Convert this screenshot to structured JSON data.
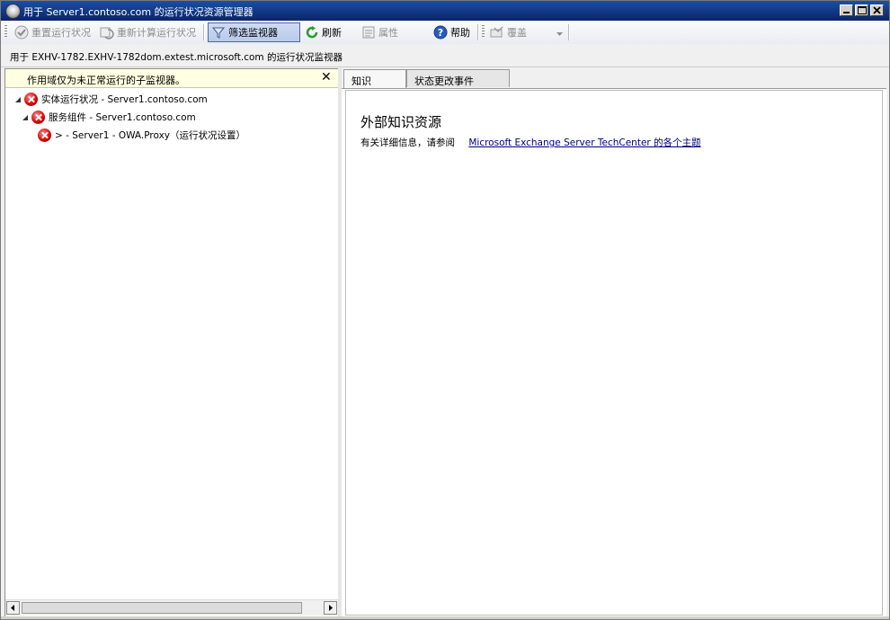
{
  "window": {
    "title": "用于 Server1.contoso.com 的运行状况资源管理器"
  },
  "toolbar": {
    "reset_health": "重置运行状况",
    "recalc_health": "重新计算运行状况",
    "filter_monitors": "筛选监视器",
    "refresh": "刷新",
    "properties": "属性",
    "help": "帮助",
    "override": "覆盖"
  },
  "infobar": {
    "text": "用于 EXHV-1782.EXHV-1782dom.extest.microsoft.com 的运行状况监视器"
  },
  "left_pane": {
    "scope_text": "作用域仅为未正常运行的子监视器。",
    "close_glyph": "✕",
    "tree": [
      {
        "label": "实体运行状况 - Server1.contoso.com",
        "status": "error"
      },
      {
        "label": "服务组件 - Server1.contoso.com",
        "status": "error"
      },
      {
        "label": "> - Server1 - OWA.Proxy（运行状况设置）",
        "status": "error"
      }
    ]
  },
  "tabs": [
    {
      "label": "知识",
      "selected": true
    },
    {
      "label": "状态更改事件",
      "selected": false
    }
  ],
  "knowledge": {
    "heading": "外部知识资源",
    "para_text": "有关详细信息，请参阅",
    "link_text": "Microsoft Exchange Server TechCenter 的各个主题"
  },
  "colors": {
    "titlebar": "#0a246a",
    "error_red": "#d40000",
    "link": "#00007a",
    "scope_bg": "#ffffe1"
  }
}
